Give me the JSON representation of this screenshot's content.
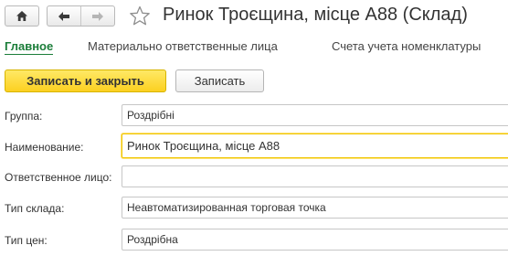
{
  "header": {
    "title": "Ринок Троєщина, місце А88 (Склад)",
    "home_icon": "home-icon",
    "back_icon": "arrow-left-icon",
    "forward_icon": "arrow-right-icon",
    "favorite_icon": "star-outline-icon"
  },
  "tabs": [
    {
      "label": "Главное",
      "active": true
    },
    {
      "label": "Материально ответственные лица",
      "active": false
    },
    {
      "label": "Счета учета номенклатуры",
      "active": false
    }
  ],
  "toolbar": {
    "save_close_label": "Записать и закрыть",
    "save_label": "Записать"
  },
  "form": {
    "group": {
      "label": "Группа:",
      "value": "Роздрібні"
    },
    "name": {
      "label": "Наименование:",
      "value": "Ринок Троєщина, місце А88"
    },
    "responsible": {
      "label": "Ответственное лицо:",
      "value": ""
    },
    "warehouse_type": {
      "label": "Тип склада:",
      "value": "Неавтоматизированная торговая точка"
    },
    "price_type": {
      "label": "Тип цен:",
      "value": "Роздрібна"
    }
  },
  "colors": {
    "accent_green": "#1b7d39",
    "primary_button": "#fcd020",
    "focus_border": "#efc500"
  }
}
